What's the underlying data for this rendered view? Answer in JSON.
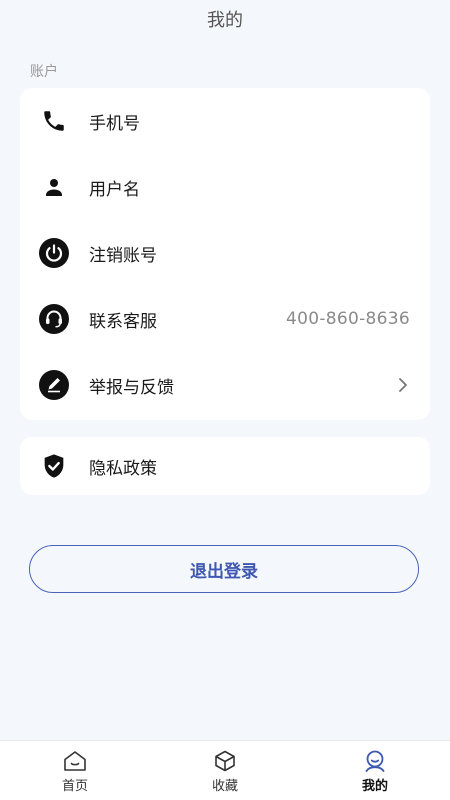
{
  "header": {
    "title": "我的"
  },
  "account": {
    "section_label": "账户",
    "items": [
      {
        "label": "手机号",
        "icon": "phone-icon"
      },
      {
        "label": "用户名",
        "icon": "user-icon"
      },
      {
        "label": "注销账号",
        "icon": "power-icon"
      },
      {
        "label": "联系客服",
        "icon": "headset-icon",
        "value": "400-860-8636"
      },
      {
        "label": "举报与反馈",
        "icon": "pencil-icon"
      }
    ]
  },
  "privacy": {
    "label": "隐私政策",
    "icon": "shield-check-icon"
  },
  "logout": {
    "label": "退出登录"
  },
  "tabbar": {
    "items": [
      {
        "label": "首页",
        "icon": "home-icon"
      },
      {
        "label": "收藏",
        "icon": "box-icon"
      },
      {
        "label": "我的",
        "icon": "profile-icon",
        "active": true
      }
    ]
  },
  "colors": {
    "accent": "#3f58b0",
    "background": "#f4f7fb",
    "card": "#ffffff"
  }
}
